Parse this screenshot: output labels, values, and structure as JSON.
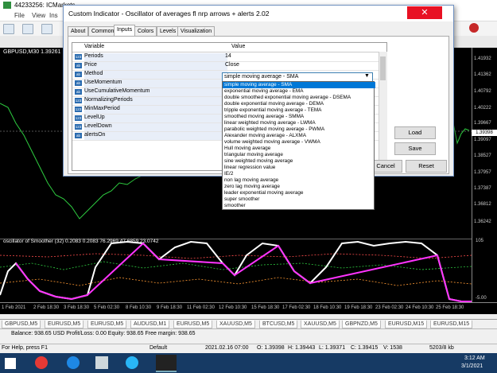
{
  "app": {
    "title": "44233256: ICMarkets-...",
    "menus": [
      "File",
      "View",
      "Ins"
    ]
  },
  "chart": {
    "symbol_label": "GBPUSD,M30  1.39261",
    "price_ticks": [
      "1.41932",
      "1.41362",
      "1.40792",
      "1.40222",
      "1.39667",
      "1.39097",
      "1.38527",
      "1.37957",
      "1.37387",
      "1.36812",
      "1.36242"
    ],
    "price_badge": "1.39398",
    "osc_label": "oscillator of Smoother (32) 0.2083 0.2083 76.2969 47.6859 23.0742",
    "osc_ticks": [
      "105",
      "-5.00"
    ],
    "time_ticks": [
      "1 Feb 2021",
      "2 Feb 18:30",
      "3 Feb 18:30",
      "5 Feb 02:30",
      "8 Feb 10:30",
      "9 Feb 18:30",
      "11 Feb 02:30",
      "12 Feb 10:30",
      "15 Feb 18:30",
      "17 Feb 02:30",
      "18 Feb 10:30",
      "19 Feb 18:30",
      "23 Feb 02:30",
      "24 Feb 10:30",
      "25 Feb 18:30"
    ]
  },
  "symbol_tabs": [
    "GBPUSD,M5",
    "EURUSD,M5",
    "EURUSD,M5",
    "AUDUSD,M1",
    "EURUSD,M5",
    "XAUUSD,M5",
    "BTCUSD,M5",
    "XAUUSD,M5",
    "GBPNZD,M5",
    "EURUSD,M15",
    "EURUSD,M15"
  ],
  "terminal": {
    "balance": "Balance: 938.65 USD  Profit/Loss: 0.00  Equity: 938.65  Free margin: 938.65"
  },
  "status": {
    "help": "For Help, press F1",
    "profile": "Default",
    "datetime": "2021.02.16 07:00",
    "open": "O: 1.39398",
    "high": "H: 1.39443",
    "low": "L: 1.39371",
    "close": "C: 1.39415",
    "volume": "V: 1538",
    "traffic": "5203/8 kb"
  },
  "taskbar": {
    "time": "3:12 AM",
    "date": "3/1/2021"
  },
  "dialog": {
    "title": "Custom Indicator - Oscillator of averages fl nrp arrows + alerts 2.02",
    "close": "✕",
    "tabs": [
      "About",
      "Common",
      "Inputs",
      "Colors",
      "Levels",
      "Visualization"
    ],
    "active_tab": "Inputs",
    "col_variable": "Variable",
    "col_value": "Value",
    "rows": [
      {
        "name": "Periods",
        "value": "14",
        "icon": "123"
      },
      {
        "name": "Price",
        "value": "Close",
        "icon": "ab"
      },
      {
        "name": "Method",
        "value": "",
        "icon": "ab"
      },
      {
        "name": "UseMomentum",
        "value": "",
        "icon": "ab"
      },
      {
        "name": "UseCumulativeMomentum",
        "value": "",
        "icon": "ab"
      },
      {
        "name": "NormalizingPeriods",
        "value": "",
        "icon": "123"
      },
      {
        "name": "MinMaxPeriod",
        "value": "",
        "icon": "123"
      },
      {
        "name": "LevelUp",
        "value": "",
        "icon": "123"
      },
      {
        "name": "LevelDown",
        "value": "",
        "icon": "123"
      },
      {
        "name": "alertsOn",
        "value": "",
        "icon": "ab"
      }
    ],
    "method_selected": "simple moving average - SMA",
    "method_options": [
      "simple moving average - SMA",
      "exponential moving average - EMA",
      "double smoothed exponential moving average - DSEMA",
      "double exponential moving average - DEMA",
      "tripple exponential moving average - TEMA",
      "smoothed moving average - SMMA",
      "linear weighted moving average - LWMA",
      "parabolic weighted moving average - PWMA",
      "Alexander moving average - ALXMA",
      "volume weighted moving average - VWMA",
      "Hull moving average",
      "triangular moving average",
      "sine weighted moving average",
      "linear regression value",
      "IE/2",
      "non lag moving average",
      "zero lag moving average",
      "leader exponential moving average",
      "super smoother",
      "smoother"
    ],
    "buttons": {
      "load": "Load",
      "save": "Save",
      "cancel": "Cancel",
      "reset": "Reset"
    }
  }
}
